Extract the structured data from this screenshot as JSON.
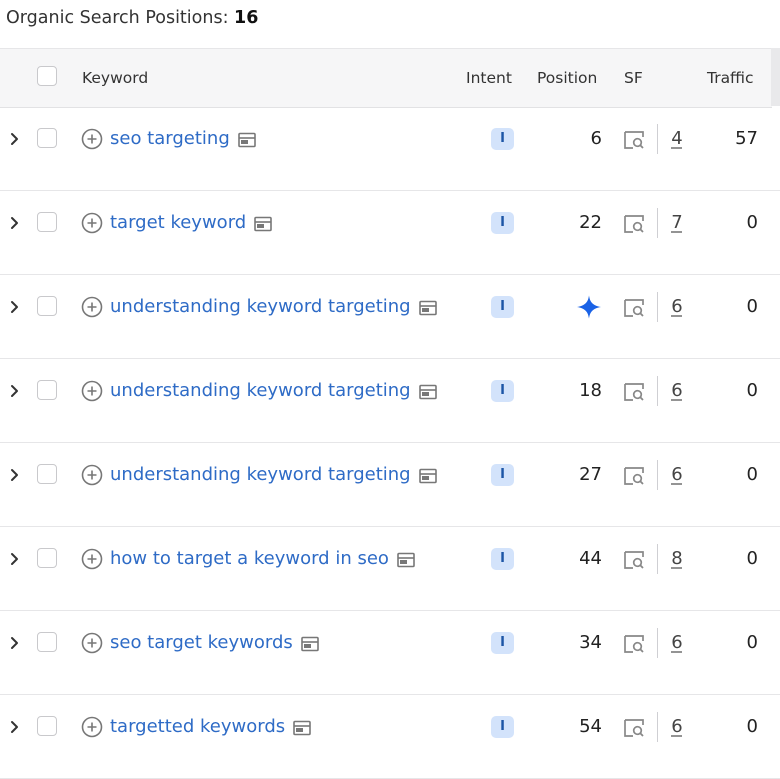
{
  "title": {
    "label": "Organic Search Positions:",
    "count": "16"
  },
  "header": {
    "keyword": "Keyword",
    "intent": "Intent",
    "position": "Position",
    "sf": "SF",
    "traffic": "Traffic"
  },
  "rows": [
    {
      "keyword": "seo targeting",
      "intent": "I",
      "position": "6",
      "sf": "4",
      "traffic": "57"
    },
    {
      "keyword": "target keyword",
      "intent": "I",
      "position": "22",
      "sf": "7",
      "traffic": "0"
    },
    {
      "keyword": "understanding keyword targeting",
      "intent": "I",
      "position": "",
      "position_icon": "ai-overview-sparkle-icon",
      "sf": "6",
      "traffic": "0"
    },
    {
      "keyword": "understanding keyword targeting",
      "intent": "I",
      "position": "18",
      "sf": "6",
      "traffic": "0"
    },
    {
      "keyword": "understanding keyword targeting",
      "intent": "I",
      "position": "27",
      "sf": "6",
      "traffic": "0"
    },
    {
      "keyword": "how to target a keyword in seo",
      "intent": "I",
      "position": "44",
      "sf": "8",
      "traffic": "0"
    },
    {
      "keyword": "seo target keywords",
      "intent": "I",
      "position": "34",
      "sf": "6",
      "traffic": "0"
    },
    {
      "keyword": "targetted keywords",
      "intent": "I",
      "position": "54",
      "sf": "6",
      "traffic": "0"
    }
  ],
  "colors": {
    "link": "#2e6bc6",
    "intent_bg": "#d3e3fb",
    "sparkle": "#1a62e6"
  },
  "icons": [
    "chevron-right-icon",
    "add-circle-icon",
    "serp-snapshot-icon",
    "serp-features-icon",
    "ai-overview-sparkle-icon"
  ]
}
